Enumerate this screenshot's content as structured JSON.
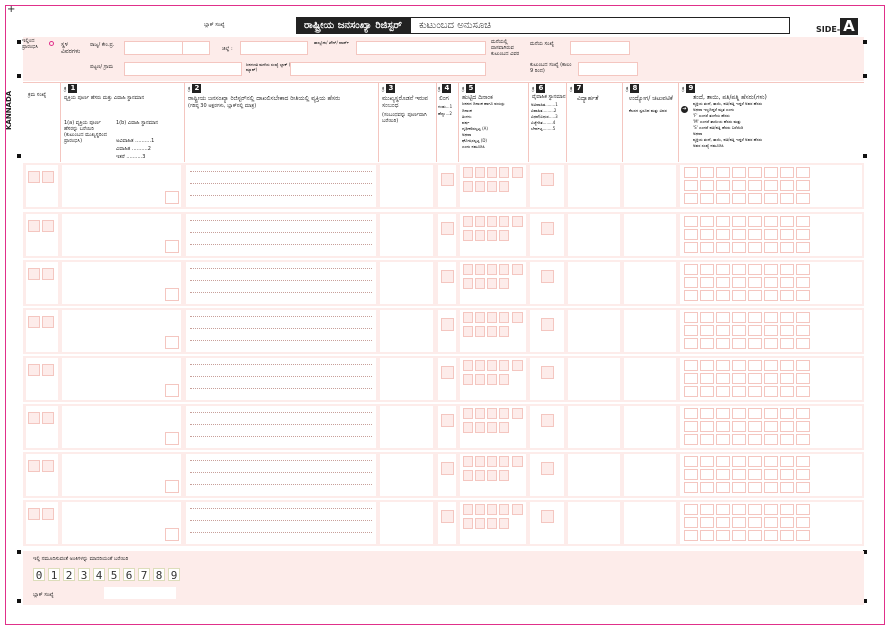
{
  "header": {
    "plus_mark": "+",
    "block_no_label": "ಬ್ಲಾಕ್ ಸಂಖ್ಯೆ",
    "title_main": "ರಾಷ್ಟ್ರೀಯ ಜನಸಂಖ್ಯಾ ರಿಜಿಸ್ಟರ್",
    "title_sub": "ಕುಟುಂಬದ ಅನುಸೂಚಿ",
    "side_label": "SIDE-",
    "side_letter": "A"
  },
  "location": {
    "left_label": "ಇಲ್ಲಿಂದ ಪ್ರಾರಂಭಿಸಿ",
    "place_details": "ಸ್ಥಳ ವಿವರಗಳು",
    "state_code": "ರಾಜ್ಯ/ ಕೇಂ.ಪ್ರ.",
    "district": "ಜಿಲ್ಲೆ :",
    "taluk": "ತಾಲ್ಲೂಕು/ ಟೌನ್/ ವಾರ್ಡ್",
    "town_village": "ಪಟ್ಟಣ/ ಗ್ರಾಮ",
    "block": "ಜನಗಣತಿ ಮನೆಯ ಸಂಖ್ಯೆ ಬ್ಲಾಕ್ (ಲೇಔಟ್ ಮ್ಯಾಪ್)",
    "house_no": "ಮನೆಯ ಸಂಖ್ಯೆ",
    "house_details": "ಮನೆಯಲ್ಲಿ ವಾಸವಾಗಿರುವ ಕುಟುಂಬದ ವಿವರ",
    "census_house": "ಜನಗಣತಿ ಮನೆಯ ಸಂಖ್ಯೆ",
    "household_no": "ಕುಟುಂಬದ ಸಂಖ್ಯೆ (ಕಾಲಂ 9 ರಿಂದ)"
  },
  "columns": {
    "kannada": "KANNADA",
    "serial": "ಕ್ರಮ ಸಂಖ್ಯೆ",
    "c1_no": "1",
    "c1_title": "ವ್ಯಕ್ತಿಯ ಪೂರ್ಣ ಹೆಸರು ಮತ್ತು ವಿವಾಹಿ ಸ್ಥಾನಮಾನ",
    "c1a": "1(a) ವ್ಯಕ್ತಿಯ ಪೂರ್ಣ ಹೆಸರನ್ನು ಬರೆಯಿರಿ (ಕುಟುಂಬದ ಮುಖ್ಯಸ್ಥರಿಂದ ಪ್ರಾರಂಭಿಸಿ)",
    "c1b": "1(b) ವಿವಾಹಿ ಸ್ಥಾನಮಾನ",
    "c1_opts": [
      "ಅವಿವಾಹಿತ ..........1",
      "ವಿವಾಹಿತ ..........2",
      "ಇತರೆ ..........3"
    ],
    "c2_no": "2",
    "c2_title": "ರಾಷ್ಟ್ರೀಯ ಜನಸಂಖ್ಯಾ ರಿಜಿಸ್ಟರ್‌ನಲ್ಲಿ ದಾಖಲಿಸಬೇಕಾದ ರೀತಿಯಲ್ಲಿ ವ್ಯಕ್ತಿಯ ಹೆಸರು",
    "c2_sub": "(ಗರಿಷ್ಠ 30 ಅಕ್ಷರಗಳು, ಬ್ಲಾಕ್‌ನಲ್ಲಿ ಮಾತ್ರ)",
    "c3_no": "3",
    "c3_title": "ಮುಖ್ಯಸ್ಥರೊಡನೆ ಇರುವ ಸಂಬಂಧ",
    "c3_sub": "(ಸಂಬಂಧವನ್ನು ಪೂರ್ಣವಾಗಿ ಬರೆಯಿರಿ)",
    "c4_no": "4",
    "c4_title": "ಲಿಂಗ",
    "c4_opts": [
      "ಗಂಡು...1",
      "ಹೆಣ್ಣು...2"
    ],
    "c5_no": "5",
    "c5_title": "ಹುಟ್ಟಿದ ದಿನಾಂಕ",
    "c5_sub": "ಜನನದ ದಿನಾಂಕ ಹಾಗೂ ವಯಸ್ಸು",
    "c5_opts": [
      "ದಿನಾಂಕ",
      "ತಿಂಗಳು",
      "ವರ್ಷ",
      "ದೃಢೀಕರಿಸಲ್ಪಟ್ಟ (A)",
      "ಅಥವಾ",
      "ಘೋಷಿಸಲ್ಪಟ್ಟ (D)",
      "ಎಂದು ನಮೂದಿಸಿ"
    ],
    "c6_no": "6",
    "c6_title": "ವೈವಾಹಿಕ ಸ್ಥಾನಮಾನ",
    "c6_opts": [
      "ಅವಿವಾಹಿತ........1",
      "ವಿವಾಹಿತ.........2",
      "ವಿಧವೆ/ವಿಧುರ.....3",
      "ವಿಚ್ಛೇದಿತ........4",
      "ಬೇರ್ಪಟ್ಟ........5"
    ],
    "c7_no": "7",
    "c7_title": "ವಿದ್ಯಾರ್ಹತೆ",
    "c8_no": "8",
    "c8_title": "ಉದ್ಯೋಗ/ ಚಟುವಟಿಕೆ",
    "c8_sub": "ಕೆಲಸದ ಸ್ವರೂಪ ಮತ್ತು ವಿವರ",
    "c9_no": "9",
    "c9_title": "ತಂದೆ, ತಾಯಿ, ಪತಿ/ಪತ್ನಿ ಹೆಸರು(ಗಳು)",
    "c9_lines": [
      "ವ್ಯಕ್ತಿಯ ತಂದೆ, ತಾಯಿ, ಪತಿ/ಪತ್ನಿ ಇದ್ದರೆ ಅವರ ಹೆಸರು",
      "ಅಥವಾ ಇಲ್ಲದಿದ್ದರೆ ಮೃತ ಎಂದು",
      "'F' ಎಂದರೆ ತಂದೆಯ ಹೆಸರು",
      "'M' ಎಂದರೆ ತಾಯಿಯ ಹೆಸರು ಮತ್ತು",
      "'S' ಎಂದರೆ ಪತಿ/ಪತ್ನಿ ಹೆಸರು ಬರೆಯಿರಿ",
      "ಅಥವಾ",
      "ವ್ಯಕ್ತಿಯ ತಂದೆ, ತಾಯಿ, ಪತಿ/ಪತ್ನಿ ಇದ್ದರೆ ಅವರ ಹೆಸರು",
      "ಅವರ ಸಂಖ್ಯೆ ನಮೂದಿಸಿ"
    ]
  },
  "footer": {
    "digits_label": "ಇಲ್ಲಿ ನಮೂದಿಸುವಂತೆ ಅಂಕಿಗಳನ್ನು ಮಾದರಿಯಂತೆ ಬರೆಯಿರಿ",
    "digits": [
      "0",
      "1",
      "2",
      "3",
      "4",
      "5",
      "6",
      "7",
      "8",
      "9"
    ],
    "block_no_label": "ಬ್ಲಾಕ್ ಸಂಖ್ಯೆ"
  }
}
